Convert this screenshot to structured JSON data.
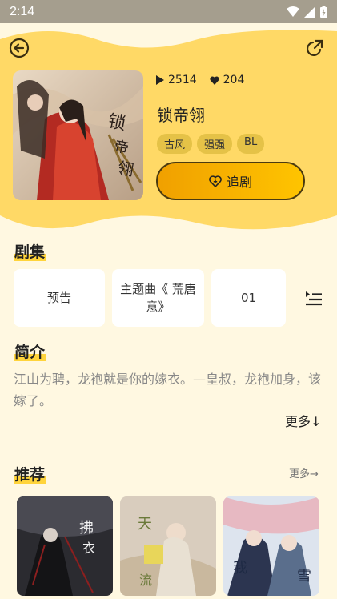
{
  "status_bar": {
    "time": "2:14"
  },
  "icons": {
    "back": "back-arrow-icon",
    "share": "share-icon",
    "play_count": "play-icon",
    "likes": "heart-icon",
    "follow": "heart-plus-icon",
    "playlist": "playlist-icon"
  },
  "drama": {
    "plays": "2514",
    "likes": "204",
    "title": "锁帝翎",
    "tags": [
      "古风",
      "强强",
      "BL"
    ],
    "follow_label": "追剧"
  },
  "episodes": {
    "title": "剧集",
    "items": [
      "预告",
      "主题曲《 荒唐意》",
      "01"
    ]
  },
  "intro": {
    "title": "简介",
    "text": "江山为聘，龙袍就是你的嫁衣。—皇叔，龙袍加身，该嫁了。",
    "more_label": "更多↓"
  },
  "recommend": {
    "title": "推荐",
    "more_label": "更多→"
  },
  "colors": {
    "header_yellow": "#FFD966",
    "accent": "#FFC400",
    "background": "#FFF8E1"
  }
}
